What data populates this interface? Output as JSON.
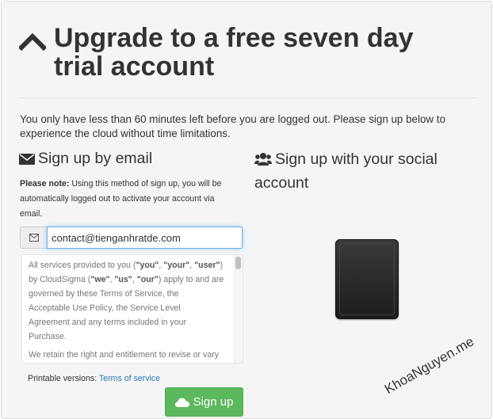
{
  "title": "Upgrade to a free seven day trial account",
  "title_line1": "Upgrade to a free seven day",
  "title_line2": "trial account",
  "intro_line1": "You only have less than 60 minutes left before you are logged out. Please sign up below to",
  "intro_line2": "experience the cloud without time limitations.",
  "email_section": {
    "heading": "Sign up by email",
    "note_label": "Please note:",
    "note_line1": "Using this method of sign up, you will be",
    "note_line2": "automatically logged out to activate your account via",
    "note_line3": "email.",
    "email_value": "contact@tienganhratde.com",
    "tos_l1a": "All services provided to you (",
    "tos_you": "\"you\"",
    "tos_sep1": ", ",
    "tos_your": "\"your\"",
    "tos_sep2": ", ",
    "tos_user": "\"user\"",
    "tos_l1b": ")",
    "tos_l2a": "by CloudSigma (",
    "tos_we": "\"we\"",
    "tos_sep3": ", ",
    "tos_us": "\"us\"",
    "tos_sep4": ", ",
    "tos_our": "\"our\"",
    "tos_l2b": ") apply to and are",
    "tos_l3": "governed by these Terms of Service, the",
    "tos_l4": "Acceptable Use Policy, the Service Level",
    "tos_l5": "Agreement and any terms included in your",
    "tos_l6": "Purchase.",
    "tos_p2": "We retain the right and entitlement to revise or vary",
    "printable_label": "Printable versions:",
    "printable_link": "Terms of service",
    "signup_label": "Sign up"
  },
  "social_section": {
    "heading_line1": "Sign up with your social",
    "heading_line2": "account"
  },
  "watermark": "KhoaNguyen.me",
  "colors": {
    "button": "#5cb85c",
    "link": "#2a7ab0",
    "focus": "#66afe9"
  }
}
